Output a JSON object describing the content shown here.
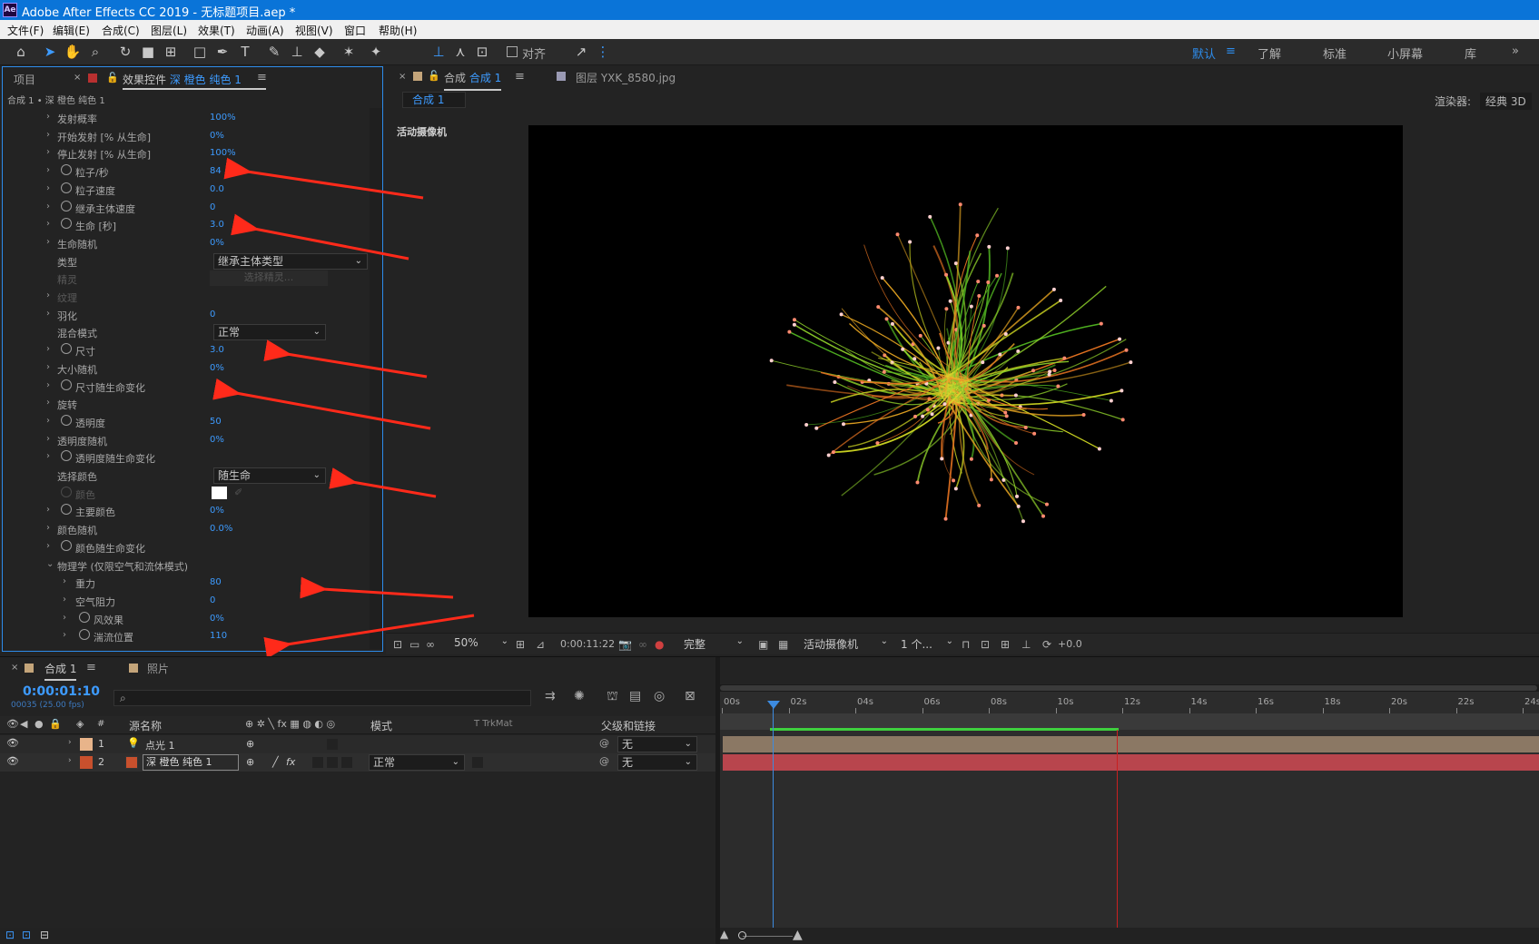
{
  "window": {
    "title": "Adobe After Effects CC 2019 - 无标题项目.aep *",
    "logo": "Ae"
  },
  "menu": [
    "文件(F)",
    "编辑(E)",
    "合成(C)",
    "图层(L)",
    "效果(T)",
    "动画(A)",
    "视图(V)",
    "窗口",
    "帮助(H)"
  ],
  "toolbar": {
    "snap_label": "对齐",
    "workspaces": [
      "默认",
      "了解",
      "标准",
      "小屏幕",
      "库"
    ]
  },
  "left_panel": {
    "tab_project": "项目",
    "tab_effects_prefix": "效果控件",
    "tab_effects_layer": "深 橙色 纯色 1",
    "breadcrumb": "合成 1 • 深 橙色 纯色 1",
    "properties": [
      {
        "name": "发射概率",
        "value": "100%"
      },
      {
        "name": "开始发射 [% 从生命]",
        "value": "0%"
      },
      {
        "name": "停止发射 [% 从生命]",
        "value": "100%"
      },
      {
        "name": "粒子/秒",
        "value": "84"
      },
      {
        "name": "粒子速度",
        "value": "0.0"
      },
      {
        "name": "继承主体速度",
        "value": "0"
      },
      {
        "name": "生命 [秒]",
        "value": "3.0"
      },
      {
        "name": "生命随机",
        "value": "0%"
      },
      {
        "name": "类型",
        "value": ""
      },
      {
        "name": "精灵",
        "value": ""
      },
      {
        "name": "纹理",
        "value": ""
      },
      {
        "name": "羽化",
        "value": "0"
      },
      {
        "name": "混合模式",
        "value": ""
      },
      {
        "name": "尺寸",
        "value": "3.0"
      },
      {
        "name": "大小随机",
        "value": "0%"
      },
      {
        "name": "尺寸随生命变化",
        "value": ""
      },
      {
        "name": "旋转",
        "value": ""
      },
      {
        "name": "透明度",
        "value": "50"
      },
      {
        "name": "透明度随机",
        "value": "0%"
      },
      {
        "name": "透明度随生命变化",
        "value": ""
      },
      {
        "name": "选择颜色",
        "value": ""
      },
      {
        "name": "颜色",
        "value": ""
      },
      {
        "name": "主要颜色",
        "value": "0%"
      },
      {
        "name": "颜色随机",
        "value": "0.0%"
      },
      {
        "name": "颜色随生命变化",
        "value": ""
      },
      {
        "name": "物理学 (仅限空气和流体模式)",
        "value": ""
      },
      {
        "name": "重力",
        "value": "80"
      },
      {
        "name": "空气阻力",
        "value": "0"
      },
      {
        "name": "风效果",
        "value": "0%"
      },
      {
        "name": "湍流位置",
        "value": "110"
      }
    ],
    "type_dropdown": "继承主体类型",
    "sprite_button": "选择精灵...",
    "blend_dropdown": "正常",
    "color_dropdown": "随生命"
  },
  "comp_panel": {
    "tab_comp_prefix": "合成",
    "tab_comp_name": "合成 1",
    "tab_layer": "图层 YXK_8580.jpg",
    "sub_tab": "合成 1",
    "renderer_label": "渲染器:",
    "renderer_value": "经典 3D",
    "camera_label": "活动摄像机",
    "footer": {
      "zoom": "50%",
      "timecode": "0:00:11:22",
      "resolution": "完整",
      "camera": "活动摄像机",
      "views": "1 个...",
      "exposure": "+0.0"
    }
  },
  "timeline": {
    "tab_comp": "合成 1",
    "tab_photo": "照片",
    "timecode": "0:00:01:10",
    "frame_info": "00035 (25.00 fps)",
    "search_placeholder": "",
    "col_source": "源名称",
    "col_mode": "模式",
    "col_trk": "T   TrkMat",
    "col_parent": "父级和链接",
    "layers": [
      {
        "num": "1",
        "name": "点光 1",
        "mode": "",
        "parent": "无",
        "color": "#e8b48a"
      },
      {
        "num": "2",
        "name": "深 橙色 纯色 1",
        "mode": "正常",
        "parent": "无",
        "color": "#c8502d"
      }
    ],
    "ticks": [
      "00s",
      "02s",
      "04s",
      "06s",
      "08s",
      "10s",
      "12s",
      "14s",
      "16s",
      "18s",
      "20s",
      "22s",
      "24s"
    ]
  }
}
